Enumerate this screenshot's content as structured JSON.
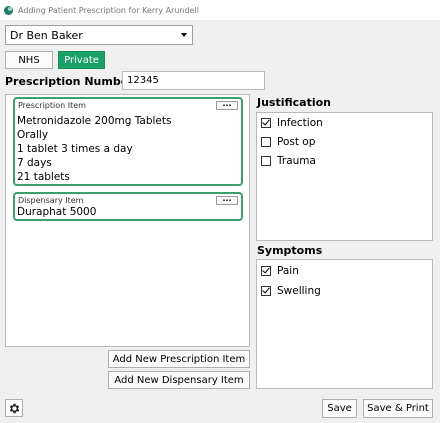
{
  "window": {
    "title": "Adding Patient Prescription for Kerry Arundell"
  },
  "doctor_select": {
    "value": "Dr Ben Baker"
  },
  "type_buttons": {
    "nhs": "NHS",
    "private": "Private"
  },
  "prescription_number": {
    "label": "Prescription Number",
    "value": "12345"
  },
  "prescription_item": {
    "caption": "Prescription Item",
    "menu": "...",
    "lines": [
      "Metronidazole 200mg Tablets",
      "Orally",
      "1 tablet 3 times a day",
      "7 days",
      "21 tablets"
    ]
  },
  "dispensary_item": {
    "caption": "Dispensary Item",
    "menu": "...",
    "lines": [
      "Duraphat 5000"
    ]
  },
  "justification": {
    "title": "Justification",
    "options": [
      {
        "label": "Infection",
        "checked": true
      },
      {
        "label": "Post op",
        "checked": false
      },
      {
        "label": "Trauma",
        "checked": false
      }
    ]
  },
  "symptoms": {
    "title": "Symptoms",
    "options": [
      {
        "label": "Pain",
        "checked": true
      },
      {
        "label": "Swelling",
        "checked": true
      }
    ]
  },
  "buttons": {
    "add_prescription": "Add New Prescription Item",
    "add_dispensary": "Add New Dispensary Item",
    "save": "Save",
    "save_print": "Save & Print"
  },
  "icons": {
    "app": "app-icon",
    "settings": "gear-icon"
  },
  "colors": {
    "accent": "#1aa067",
    "card_border": "#3f9f6a"
  }
}
